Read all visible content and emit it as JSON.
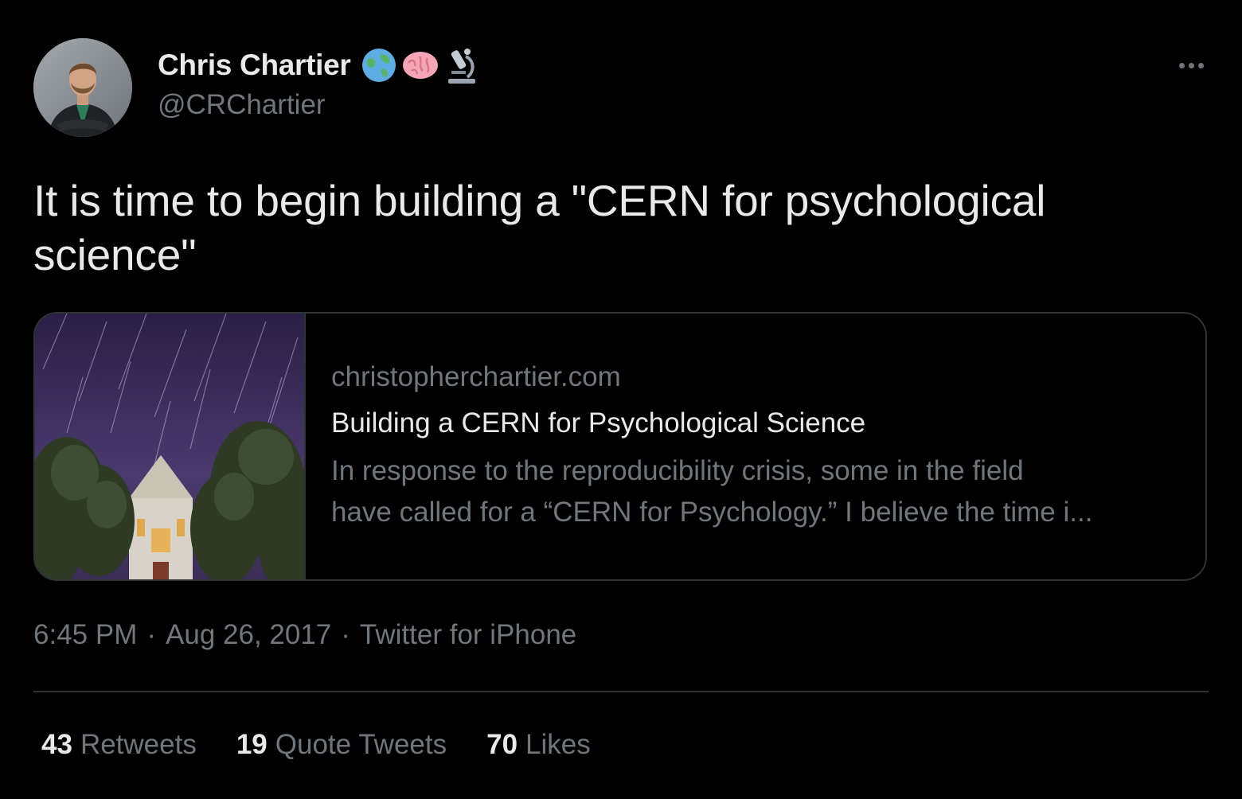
{
  "author": {
    "display_name": "Chris Chartier",
    "handle": "@CRChartier",
    "badges": [
      "globe-icon",
      "brain-icon",
      "microscope-icon"
    ]
  },
  "tweet": {
    "text": "It is time to begin building a \"CERN for psychological science\""
  },
  "link_card": {
    "domain": "christopherchartier.com",
    "title": "Building a CERN for Psychological Science",
    "description": "In response to the reproducibility crisis, some in the field\nhave called for a “CERN for Psychology.” I believe the time i..."
  },
  "meta": {
    "time": "6:45 PM",
    "separator": "·",
    "date": "Aug 26, 2017",
    "source": "Twitter for iPhone"
  },
  "stats": {
    "retweets": {
      "count": "43",
      "label": "Retweets"
    },
    "quote_tweets": {
      "count": "19",
      "label": "Quote Tweets"
    },
    "likes": {
      "count": "70",
      "label": "Likes"
    }
  },
  "colors": {
    "background": "#000000",
    "primary_text": "#e7e9ea",
    "secondary_text": "#71767b",
    "border": "#2f3336"
  }
}
